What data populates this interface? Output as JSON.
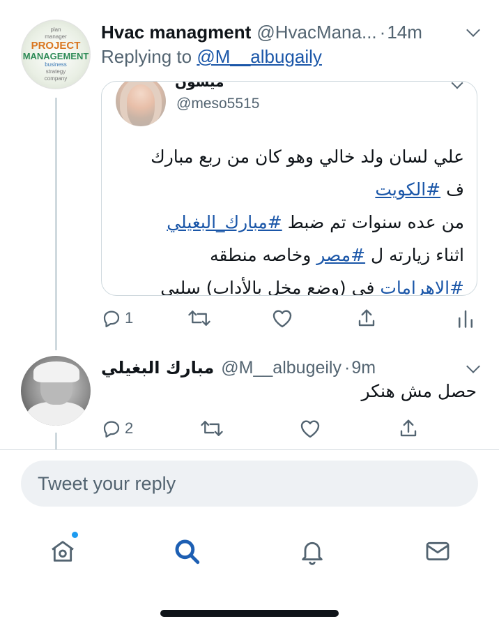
{
  "tweet1": {
    "name": "Hvac managment",
    "handle": "@HvacMana...",
    "time_sep": "·",
    "time": "14m",
    "replying_prefix": "Replying to ",
    "replying_to": "@M__albugaily",
    "avatar_text": [
      "plan",
      "manager",
      "PROJECT",
      "MANAGEMENT",
      "business",
      "strategy",
      "company"
    ],
    "quote": {
      "name": "ميسون",
      "handle": "@meso5515",
      "lines": [
        {
          "text": "علي لسان ولد خالي وهو كان من ربع مبارك"
        },
        {
          "pre": "ف ",
          "tag": "#الكويت",
          "post": ""
        },
        {
          "pre": "من عده سنوات تم ضبط ",
          "tag": "#مبارك_البغيلي",
          "post": ""
        },
        {
          "pre": "اثناء زيارته ل ",
          "tag": "#مصر",
          "post": " وخاصه منطقه"
        },
        {
          "pre": "",
          "tag": "#الاهرامات",
          "post": " في (وضع مخل بالأداب) سلبي"
        }
      ]
    },
    "actions": {
      "reply_count": "1"
    }
  },
  "tweet2": {
    "name": "مبارك البغيلي",
    "handle": "@M__albugeily",
    "time_sep": "·",
    "time": "9m",
    "text": "حصل مش هنكر",
    "actions": {
      "reply_count": "2"
    }
  },
  "reply_box": {
    "placeholder": "Tweet your reply"
  },
  "tabbar": {
    "items": [
      "home",
      "search",
      "notifications",
      "messages"
    ],
    "active": "search",
    "home_has_dot": true
  },
  "colors": {
    "accent": "#1d9bf0",
    "link": "#1a56a8",
    "muted": "#536471"
  }
}
